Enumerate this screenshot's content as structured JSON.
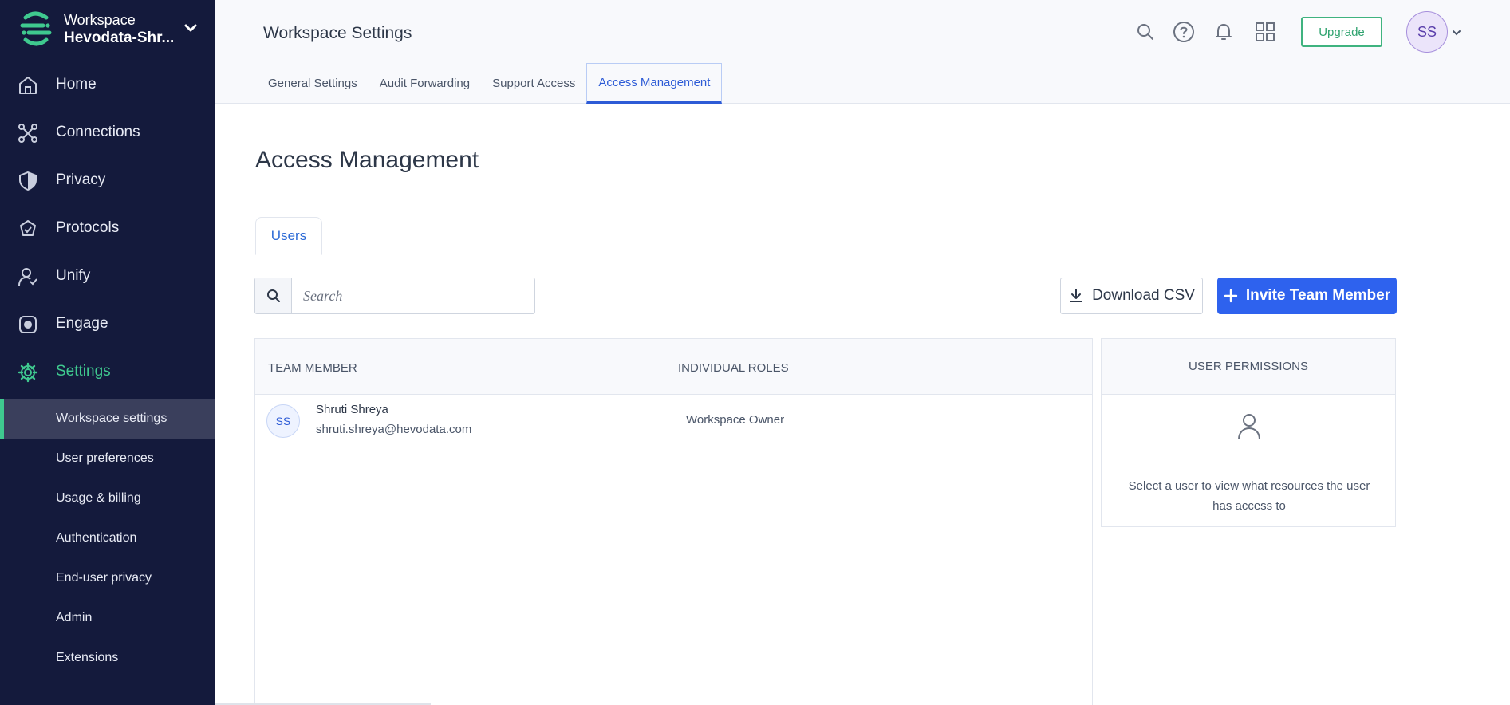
{
  "sidebar": {
    "workspace_label": "Workspace",
    "workspace_name": "Hevodata-Shr...",
    "nav": [
      {
        "label": "Home",
        "icon": "home-icon"
      },
      {
        "label": "Connections",
        "icon": "connections-icon"
      },
      {
        "label": "Privacy",
        "icon": "shield-icon"
      },
      {
        "label": "Protocols",
        "icon": "protocols-icon"
      },
      {
        "label": "Unify",
        "icon": "unify-icon"
      },
      {
        "label": "Engage",
        "icon": "engage-icon"
      },
      {
        "label": "Settings",
        "icon": "gear-icon",
        "active": true
      }
    ],
    "settings_items": [
      {
        "label": "Workspace settings",
        "active": true
      },
      {
        "label": "User preferences"
      },
      {
        "label": "Usage & billing"
      },
      {
        "label": "Authentication"
      },
      {
        "label": "End-user privacy"
      },
      {
        "label": "Admin"
      },
      {
        "label": "Extensions"
      }
    ]
  },
  "header": {
    "title": "Workspace Settings",
    "upgrade_label": "Upgrade",
    "avatar_initials": "SS",
    "icons": [
      "search-icon",
      "help-icon",
      "bell-icon",
      "apps-grid-icon"
    ],
    "tabs": [
      {
        "label": "General Settings"
      },
      {
        "label": "Audit Forwarding"
      },
      {
        "label": "Support Access"
      },
      {
        "label": "Access Management",
        "active": true
      }
    ]
  },
  "main": {
    "title": "Access Management",
    "inner_tab": "Users",
    "search_placeholder": "Search",
    "download_label": "Download CSV",
    "invite_label": "Invite Team Member",
    "table": {
      "col_member": "TEAM MEMBER",
      "col_roles": "INDIVIDUAL ROLES",
      "rows": [
        {
          "initials": "SS",
          "name": "Shruti Shreya",
          "email": "shruti.shreya@hevodata.com",
          "role": "Workspace Owner"
        }
      ]
    },
    "permissions": {
      "title": "USER PERMISSIONS",
      "hint": "Select a user to view what resources the user has access to"
    }
  },
  "colors": {
    "sidebar_bg": "#141a3c",
    "accent_green": "#3fc98f",
    "primary_blue": "#2e62ee",
    "tab_blue": "#2d5bd6"
  }
}
